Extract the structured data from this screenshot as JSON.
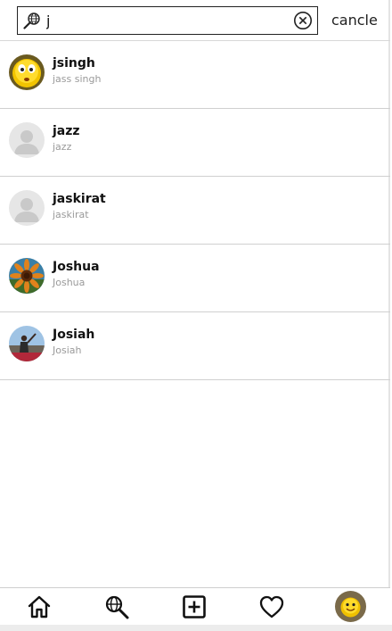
{
  "search": {
    "query": "j",
    "placeholder": "",
    "cancel_label": "cancle"
  },
  "results": [
    {
      "username": "jsingh",
      "full_name": "jass singh",
      "avatar": "emoji-face"
    },
    {
      "username": "jazz",
      "full_name": "jazz",
      "avatar": "default-silhouette"
    },
    {
      "username": "jaskirat",
      "full_name": "jaskirat",
      "avatar": "default-silhouette"
    },
    {
      "username": "Joshua",
      "full_name": "Joshua",
      "avatar": "sunflower-photo"
    },
    {
      "username": "Josiah",
      "full_name": "Josiah",
      "avatar": "outdoor-photo"
    }
  ],
  "nav": {
    "items": [
      "home-icon",
      "search-icon",
      "add-post-icon",
      "heart-icon",
      "profile-avatar"
    ]
  },
  "colors": {
    "divider": "#d0d0d0",
    "secondary_text": "#9a9a9a"
  }
}
